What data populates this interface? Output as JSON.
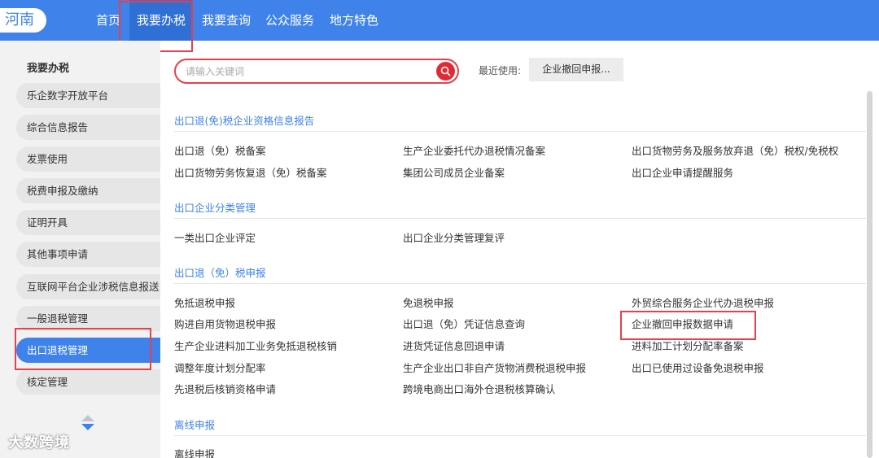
{
  "header": {
    "province": "河南",
    "nav": [
      "首页",
      "我要办税",
      "我要查询",
      "公众服务",
      "地方特色"
    ]
  },
  "sidebar": {
    "title": "我要办税",
    "items": [
      "乐企数字开放平台",
      "综合信息报告",
      "发票使用",
      "税费申报及缴纳",
      "证明开具",
      "其他事项申请",
      "互联网平台企业涉税信息报送",
      "一般退税管理",
      "出口退税管理",
      "核定管理"
    ],
    "active_index": 8
  },
  "search": {
    "placeholder": "请输入关键词",
    "recent_label": "最近使用:",
    "recent_item": "企业撤回申报..."
  },
  "sections": [
    {
      "title": "出口退(免)税企业资格信息报告",
      "links": [
        "出口退（免）税备案",
        "生产企业委托代办退税情况备案",
        "出口货物劳务及服务放弃退（免）税权/免税权",
        "出口货物劳务恢复退（免）税备案",
        "集团公司成员企业备案",
        "出口企业申请提醒服务"
      ]
    },
    {
      "title": "出口企业分类管理",
      "links": [
        "一类出口企业评定",
        "出口企业分类管理复评"
      ]
    },
    {
      "title": "出口退（免）税申报",
      "links": [
        "免抵退税申报",
        "免退税申报",
        "外贸综合服务企业代办退税申报",
        "购进自用货物退税申报",
        "出口退（免）凭证信息查询",
        "企业撤回申报数据申请",
        "生产企业进料加工业务免抵退税核销",
        "进货凭证信息回退申请",
        "进料加工计划分配率备案",
        "调整年度计划分配率",
        "生产企业出口非自产货物消费税退税申报",
        "出口已使用过设备免退税申报",
        "先退税后核销资格申请",
        "跨境电商出口海外仓退税核算确认"
      ]
    },
    {
      "title": "离线申报",
      "links": [
        "离线申报"
      ]
    }
  ],
  "watermark": "大数跨境",
  "colors": {
    "brand_blue": "#3f83ea",
    "highlight_red": "#e5414b"
  }
}
